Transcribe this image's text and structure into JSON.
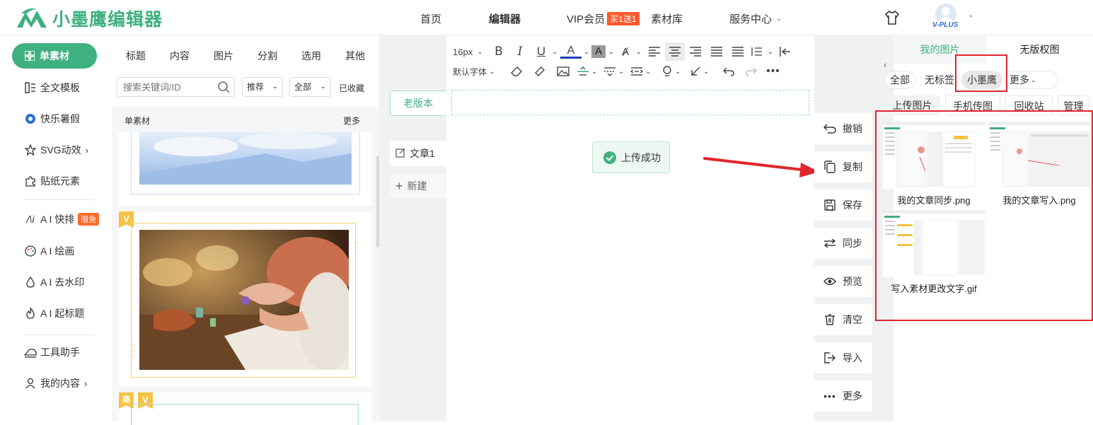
{
  "header": {
    "logo_text": "小墨鹰编辑器",
    "nav": {
      "home": "首页",
      "editor": "编辑器",
      "vip": "VIP会员",
      "vip_badge": "买1送1",
      "library": "素材库",
      "service": "服务中心"
    },
    "user_badge": "V-PLUS"
  },
  "left_nav": {
    "items": [
      {
        "label": "单素材"
      },
      {
        "label": "全文模板"
      },
      {
        "label": "快乐暑假"
      },
      {
        "label": "SVG动效"
      },
      {
        "label": "贴纸元素"
      },
      {
        "label": "A I 快排",
        "badge": "限免"
      },
      {
        "label": "A I 绘画"
      },
      {
        "label": "A I 去水印"
      },
      {
        "label": "A I 起标题"
      },
      {
        "label": "工具助手"
      },
      {
        "label": "我的内容"
      }
    ]
  },
  "materials": {
    "tabs": [
      "标题",
      "内容",
      "图片",
      "分割",
      "选用",
      "其他"
    ],
    "search_placeholder": "搜索关键词/ID",
    "sort": "推荐",
    "filter": "全部",
    "favorites": "已收藏",
    "section_title": "单素材",
    "more": "更多",
    "card_tags": {
      "v": "V",
      "shang": "商"
    }
  },
  "middle": {
    "old_version": "老版本",
    "doc_name": "文章1",
    "new_doc": "新建"
  },
  "editor": {
    "font_size": "16px",
    "font_family": "默认字体",
    "toast": "上传成功"
  },
  "actions": [
    "撤销",
    "复制",
    "保存",
    "同步",
    "预览",
    "清空",
    "导入",
    "更多"
  ],
  "right_panel": {
    "tabs": [
      "我的图片",
      "无版权图"
    ],
    "chips": [
      "全部",
      "无标签",
      "小墨鹰",
      "更多"
    ],
    "buttons": [
      "上传图片",
      "手机传图",
      "回收站",
      "管理"
    ],
    "images": [
      {
        "name": "我的文章同步.png"
      },
      {
        "name": "我的文章写入.png"
      },
      {
        "name": "写入素材更改文字.gif"
      }
    ]
  },
  "colors": {
    "brand": "#3fb07f",
    "accent_red": "#e0262c",
    "vip_badge": "#ff5a2c"
  }
}
